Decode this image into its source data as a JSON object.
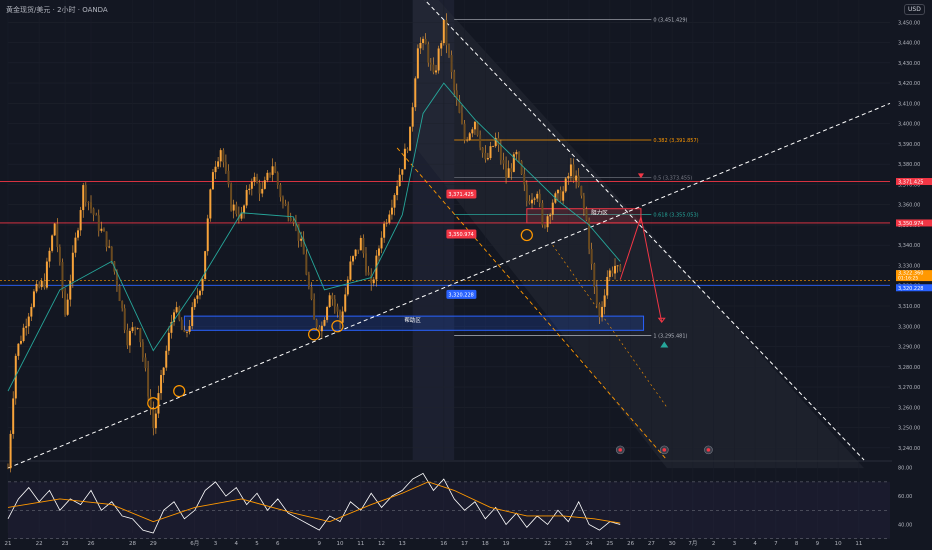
{
  "header": {
    "symbol": "黄金现货/美元",
    "interval": "2小时",
    "source": "OANDA",
    "separator": "·"
  },
  "currency_button": "USD",
  "colors": {
    "background": "#131722",
    "candle": "#f7a33a",
    "ema": "#26a69a",
    "red_line": "#f23645",
    "blue_line": "#2962ff",
    "fib": "#ff9800",
    "rsi": "#ffffff",
    "rsi_ma": "#ff9800"
  },
  "chart_data": [
    {
      "type": "candlestick",
      "y_axis": {
        "range": [
          3234,
          3461
        ],
        "ticks": [
          3240,
          3250,
          3260,
          3270,
          3280,
          3290,
          3300,
          3310,
          3320,
          3330,
          3340,
          3350,
          3360,
          3370,
          3380,
          3390,
          3400,
          3410,
          3420,
          3430,
          3440,
          3450
        ],
        "tick_labels": [
          "3,240.00",
          "3,250.00",
          "3,260.00",
          "3,270.00",
          "3,280.00",
          "3,290.00",
          "3,300.00",
          "3,310.00",
          "3,320.00",
          "3,330.00",
          "3,340.00",
          "3,350.00",
          "3,360.00",
          "3,370.00",
          "3,380.00",
          "3,390.00",
          "3,400.00",
          "3,410.00",
          "3,420.00",
          "3,430.00",
          "3,440.00",
          "3,450.00"
        ]
      },
      "x_axis": {
        "tick_labels": [
          "21",
          "22",
          "23",
          "26",
          "28",
          "29",
          "6月",
          "3",
          "4",
          "5",
          "6",
          "9",
          "10",
          "11",
          "12",
          "13",
          "16",
          "17",
          "18",
          "19",
          "22",
          "23",
          "24",
          "25",
          "26",
          "27",
          "30",
          "7月",
          "2",
          "3",
          "4",
          "7",
          "8",
          "9",
          "10",
          "11"
        ],
        "tick_bars": [
          0,
          12,
          22,
          32,
          48,
          56,
          72,
          80,
          88,
          96,
          104,
          120,
          128,
          136,
          144,
          152,
          168,
          176,
          184,
          192,
          208,
          216,
          224,
          232,
          240,
          248,
          256,
          264,
          272,
          280,
          288,
          296,
          304,
          312,
          320,
          328
        ]
      },
      "series_path": [
        [
          0,
          3230
        ],
        [
          3,
          3286
        ],
        [
          10,
          3316
        ],
        [
          14,
          3322
        ],
        [
          18,
          3351
        ],
        [
          22,
          3306
        ],
        [
          26,
          3342
        ],
        [
          29,
          3368
        ],
        [
          34,
          3352
        ],
        [
          38,
          3342
        ],
        [
          42,
          3322
        ],
        [
          46,
          3294
        ],
        [
          50,
          3302
        ],
        [
          54,
          3268
        ],
        [
          56,
          3250
        ],
        [
          60,
          3280
        ],
        [
          64,
          3310
        ],
        [
          68,
          3294
        ],
        [
          70,
          3302
        ],
        [
          75,
          3325
        ],
        [
          79,
          3378
        ],
        [
          82,
          3388
        ],
        [
          86,
          3360
        ],
        [
          90,
          3354
        ],
        [
          94,
          3374
        ],
        [
          98,
          3366
        ],
        [
          102,
          3380
        ],
        [
          106,
          3360
        ],
        [
          110,
          3354
        ],
        [
          114,
          3335
        ],
        [
          118,
          3302
        ],
        [
          121,
          3300
        ],
        [
          124,
          3318
        ],
        [
          128,
          3302
        ],
        [
          132,
          3330
        ],
        [
          136,
          3342
        ],
        [
          140,
          3318
        ],
        [
          144,
          3346
        ],
        [
          148,
          3362
        ],
        [
          152,
          3380
        ],
        [
          155,
          3395
        ],
        [
          158,
          3440
        ],
        [
          161,
          3438
        ],
        [
          164,
          3422
        ],
        [
          168,
          3448
        ],
        [
          172,
          3416
        ],
        [
          176,
          3392
        ],
        [
          180,
          3402
        ],
        [
          184,
          3380
        ],
        [
          188,
          3392
        ],
        [
          192,
          3374
        ],
        [
          196,
          3384
        ],
        [
          200,
          3362
        ],
        [
          204,
          3368
        ],
        [
          206,
          3348
        ],
        [
          210,
          3362
        ],
        [
          214,
          3366
        ],
        [
          217,
          3378
        ],
        [
          220,
          3368
        ],
        [
          223,
          3352
        ],
        [
          226,
          3318
        ],
        [
          228,
          3304
        ],
        [
          231,
          3325
        ],
        [
          234,
          3330
        ],
        [
          236,
          3324
        ]
      ],
      "ema_path": [
        [
          0,
          3268
        ],
        [
          20,
          3318
        ],
        [
          40,
          3332
        ],
        [
          56,
          3288
        ],
        [
          72,
          3318
        ],
        [
          90,
          3356
        ],
        [
          110,
          3354
        ],
        [
          122,
          3318
        ],
        [
          140,
          3324
        ],
        [
          152,
          3355
        ],
        [
          160,
          3405
        ],
        [
          168,
          3420
        ],
        [
          180,
          3402
        ],
        [
          196,
          3382
        ],
        [
          212,
          3362
        ],
        [
          224,
          3350
        ],
        [
          236,
          3332
        ]
      ],
      "horizontal_levels": [
        {
          "price": 3371.425,
          "label": "3,371.425",
          "color": "#f23645"
        },
        {
          "price": 3350.974,
          "label": "3,350.974",
          "color": "#f23645"
        },
        {
          "price": 3320.228,
          "label": "3,320.228",
          "color": "#2962ff"
        },
        {
          "price": 3322.5,
          "label": "3,322.360",
          "color": "#ff9800"
        }
      ],
      "price_tags": [
        {
          "label": "3,371.425",
          "color": "#f23645"
        },
        {
          "label": "3,350.974",
          "color": "#f23645"
        },
        {
          "label": "3,322.360",
          "sub": "01:16:25",
          "color": "#ff9800"
        },
        {
          "label": "3,320.228",
          "color": "#2962ff"
        }
      ],
      "inner_labels": [
        {
          "text": "3,371.425",
          "bar": 169,
          "price": 3365,
          "color": "#f23645"
        },
        {
          "text": "3,350.974",
          "bar": 169,
          "price": 3345.3,
          "color": "#f23645"
        },
        {
          "text": "3,320.228",
          "bar": 169,
          "price": 3315.5,
          "color": "#2962ff"
        }
      ],
      "fib_levels": [
        {
          "text": "0 (3,451.429)",
          "price": 3451.4,
          "color": "#b2b5be"
        },
        {
          "text": "0.382 (3,391.857)",
          "price": 3391.9,
          "color": "#ff9800"
        },
        {
          "text": "0.5 (3,373.455)",
          "price": 3373.5,
          "color": "#787b86"
        },
        {
          "text": "0.618 (3,355.053)",
          "price": 3355.1,
          "color": "#26a69a"
        },
        {
          "text": "1 (3,295.481)",
          "price": 3295.5,
          "color": "#b2b5be"
        }
      ],
      "zones": [
        {
          "text": "帮助区",
          "price_top": 3305,
          "price_bottom": 3298
        },
        {
          "text": "阻力区",
          "price_top": 3358,
          "price_bottom": 3351
        }
      ],
      "events_count": 3
    },
    {
      "type": "line",
      "y_axis": {
        "ticks": [
          40,
          60,
          80
        ],
        "tick_labels": [
          "40.00",
          "60.00",
          "80.00"
        ],
        "range": [
          34,
          84
        ]
      },
      "levels": [
        70,
        50,
        30
      ],
      "rsi_path": [
        [
          0,
          44
        ],
        [
          4,
          58
        ],
        [
          8,
          66
        ],
        [
          12,
          56
        ],
        [
          16,
          64
        ],
        [
          20,
          50
        ],
        [
          24,
          58
        ],
        [
          28,
          54
        ],
        [
          32,
          64
        ],
        [
          36,
          50
        ],
        [
          40,
          56
        ],
        [
          44,
          46
        ],
        [
          48,
          44
        ],
        [
          52,
          36
        ],
        [
          56,
          34
        ],
        [
          60,
          50
        ],
        [
          64,
          56
        ],
        [
          68,
          44
        ],
        [
          72,
          50
        ],
        [
          76,
          64
        ],
        [
          80,
          70
        ],
        [
          84,
          60
        ],
        [
          88,
          66
        ],
        [
          92,
          54
        ],
        [
          96,
          62
        ],
        [
          100,
          50
        ],
        [
          104,
          58
        ],
        [
          108,
          48
        ],
        [
          112,
          44
        ],
        [
          116,
          40
        ],
        [
          120,
          36
        ],
        [
          124,
          46
        ],
        [
          128,
          42
        ],
        [
          132,
          56
        ],
        [
          136,
          50
        ],
        [
          140,
          62
        ],
        [
          144,
          52
        ],
        [
          148,
          60
        ],
        [
          152,
          64
        ],
        [
          156,
          72
        ],
        [
          160,
          76
        ],
        [
          164,
          64
        ],
        [
          168,
          72
        ],
        [
          172,
          58
        ],
        [
          176,
          50
        ],
        [
          180,
          56
        ],
        [
          184,
          44
        ],
        [
          188,
          52
        ],
        [
          192,
          40
        ],
        [
          196,
          48
        ],
        [
          200,
          38
        ],
        [
          204,
          46
        ],
        [
          208,
          40
        ],
        [
          212,
          50
        ],
        [
          216,
          42
        ],
        [
          220,
          56
        ],
        [
          224,
          40
        ],
        [
          228,
          36
        ],
        [
          232,
          42
        ],
        [
          236,
          40
        ]
      ],
      "ma_path": [
        [
          0,
          52
        ],
        [
          20,
          58
        ],
        [
          40,
          54
        ],
        [
          56,
          42
        ],
        [
          72,
          52
        ],
        [
          90,
          58
        ],
        [
          110,
          48
        ],
        [
          124,
          42
        ],
        [
          140,
          54
        ],
        [
          152,
          62
        ],
        [
          162,
          70
        ],
        [
          172,
          64
        ],
        [
          186,
          52
        ],
        [
          200,
          46
        ],
        [
          214,
          46
        ],
        [
          226,
          44
        ],
        [
          236,
          41
        ]
      ]
    }
  ]
}
